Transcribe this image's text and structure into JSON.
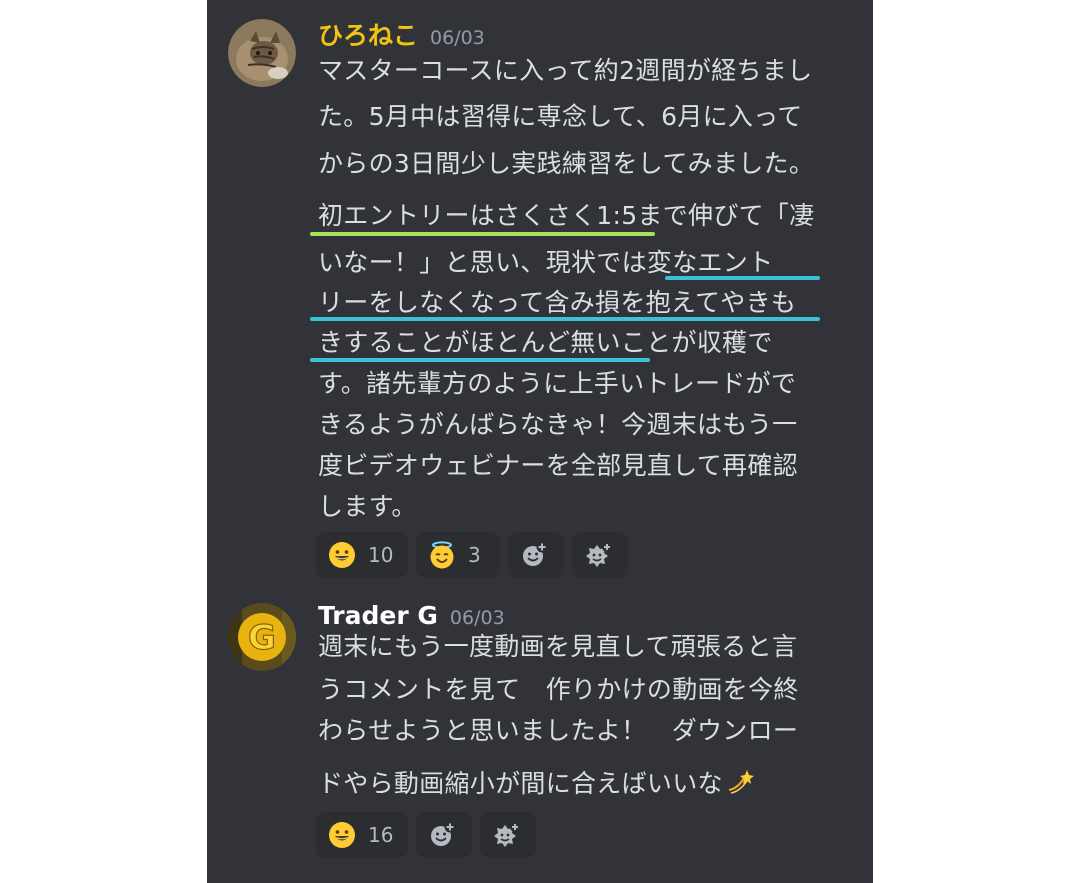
{
  "colors": {
    "panel_bg": "#313338",
    "text": "#dbdee1",
    "muted": "#949ba4",
    "username_hironeko": "#f1c40f",
    "username_trader": "#ffffff",
    "underline_green": "#a6e35b",
    "underline_cyan": "#37c4d6",
    "reaction_bg": "#2b2d31"
  },
  "messages": [
    {
      "username": "ひろねこ",
      "timestamp": "06/03",
      "avatar_icon": "cat-avatar",
      "lines": [
        "マスターコースに入って約2週間が経ちまし",
        "た。5月中は習得に専念して、6月に入って",
        "からの3日間少し実践練習をしてみました。",
        "初エントリーはさくさく1:5まで伸びて「凄",
        "いなー！」と思い、現状では変なエント",
        "リーをしなくなって含み損を抱えてやきも",
        "きすることがほとんど無いことが収穫で",
        "す。諸先輩方のように上手いトレードがで",
        "きるようがんばらなきゃ！今週末はもう一",
        "度ビデオウェビナーを全部見直して再確認",
        "します。"
      ],
      "reactions": [
        {
          "emoji_icon": "grinning-face-icon",
          "count": "10"
        },
        {
          "emoji_icon": "halo-face-icon",
          "count": "3"
        },
        {
          "emoji_icon": "add-reaction-icon"
        },
        {
          "emoji_icon": "add-super-reaction-icon"
        }
      ]
    },
    {
      "username": "Trader G",
      "timestamp": "06/03",
      "avatar_icon": "g-letter-avatar",
      "lines": [
        "週末にもう一度動画を見直して頑張ると言",
        "うコメントを見て　作りかけの動画を今終",
        "わらせようと思いましたよ！　ダウンロー",
        "ドやら動画縮小が間に合えばいいな"
      ],
      "trailing_emoji_icon": "dizzy-star-icon",
      "reactions": [
        {
          "emoji_icon": "grinning-face-icon",
          "count": "16"
        },
        {
          "emoji_icon": "add-reaction-icon"
        },
        {
          "emoji_icon": "add-super-reaction-icon"
        }
      ]
    }
  ]
}
